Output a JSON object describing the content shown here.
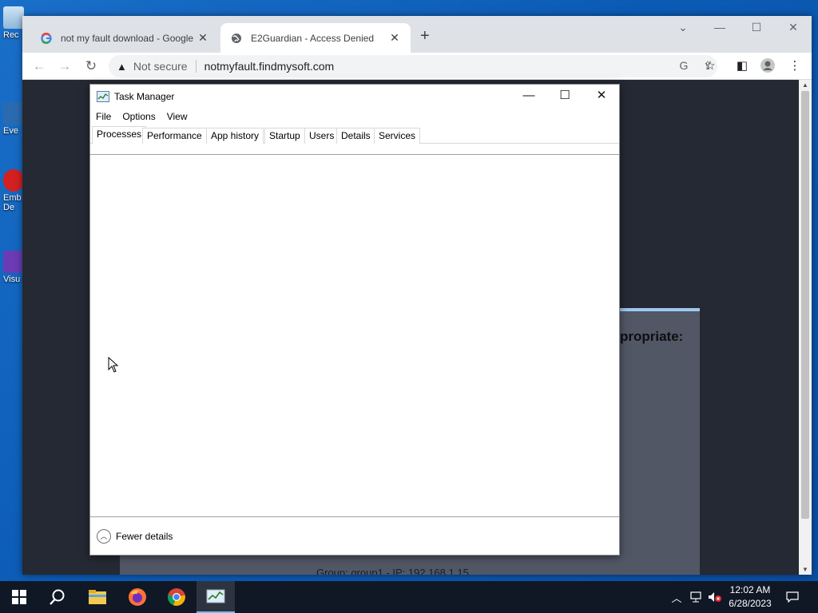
{
  "desktop": {
    "icons": [
      {
        "label": "Rec",
        "icon": "recycle-bin-icon"
      },
      {
        "label": "Eve",
        "icon": "event-viewer-icon"
      },
      {
        "label": "Emb",
        "label2": "De",
        "icon": "app-shortcut-icon"
      },
      {
        "label": "Visu",
        "icon": "visual-studio-icon"
      }
    ]
  },
  "browser": {
    "tabs": [
      {
        "title": "not my fault download - Google",
        "icon": "google-icon",
        "active": false
      },
      {
        "title": "E2Guardian - Access Denied",
        "icon": "globe-icon",
        "active": true
      }
    ],
    "new_tab_label": "+",
    "omnibox": {
      "security_label": "Not secure",
      "url": "notmyfault.findmysoft.com"
    },
    "page": {
      "panel_text": "propriate:",
      "footer_text": "Group: group1 - IP: 192.168.1.15"
    }
  },
  "task_manager": {
    "title": "Task Manager",
    "menu": [
      "File",
      "Options",
      "View"
    ],
    "tabs": [
      "Processes",
      "Performance",
      "App history",
      "Startup",
      "Users",
      "Details",
      "Services"
    ],
    "active_tab": "Processes",
    "footer_label": "Fewer details"
  },
  "taskbar": {
    "items": [
      "start-icon",
      "search-icon",
      "file-explorer-icon",
      "firefox-icon",
      "chrome-icon",
      "task-manager-icon"
    ],
    "clock": {
      "time": "12:02 AM",
      "date": "6/28/2023"
    }
  },
  "colors": {
    "desktop": "#0b5bb5",
    "taskbar": "#101826",
    "page_bg": "#252933",
    "panel": "#525766",
    "panel_accent": "#9dc8f0"
  }
}
